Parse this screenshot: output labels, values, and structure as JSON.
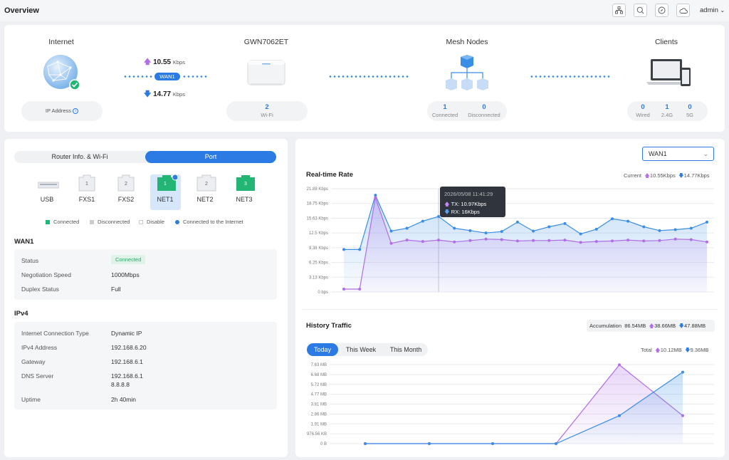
{
  "header": {
    "title": "Overview",
    "user": "admin"
  },
  "topology": {
    "internet": {
      "title": "Internet",
      "ip_label": "IP Address"
    },
    "wan": {
      "label": "WAN1",
      "up_rate": "10.55",
      "down_rate": "14.77",
      "unit": "Kbps"
    },
    "router": {
      "title": "GWN7062ET",
      "wifi_count": "2",
      "wifi_label": "Wi-Fi"
    },
    "mesh": {
      "title": "Mesh Nodes",
      "connected": "1",
      "connected_label": "Connected",
      "disconnected": "0",
      "disconnected_label": "Disconnected"
    },
    "clients": {
      "title": "Clients",
      "wired": "0",
      "wired_label": "Wired",
      "g24": "1",
      "g24_label": "2.4G",
      "g5": "0",
      "g5_label": "5G"
    }
  },
  "left": {
    "tabs": [
      "Router Info. & Wi-Fi",
      "Port"
    ],
    "ports": [
      {
        "name": "USB",
        "number": ""
      },
      {
        "name": "FXS1",
        "number": "1"
      },
      {
        "name": "FXS2",
        "number": "2"
      },
      {
        "name": "NET1",
        "number": "1"
      },
      {
        "name": "NET2",
        "number": "2"
      },
      {
        "name": "NET3",
        "number": "3"
      }
    ],
    "legend": [
      "Connected",
      "Disconnected",
      "Disable",
      "Connected to the Internet"
    ],
    "wan_title": "WAN1",
    "wan_rows": [
      {
        "label": "Status",
        "value": "Connected"
      },
      {
        "label": "Negotiation Speed",
        "value": "1000Mbps"
      },
      {
        "label": "Duplex Status",
        "value": "Full"
      }
    ],
    "ipv4_title": "IPv4",
    "ipv4_rows": [
      {
        "label": "Internet Connection Type",
        "value": "Dynamic IP"
      },
      {
        "label": "IPv4 Address",
        "value": "192.168.6.20"
      },
      {
        "label": "Gateway",
        "value": "192.168.6.1"
      },
      {
        "label": "DNS Server",
        "value": "192.168.6.1",
        "value2": "8.8.8.8"
      },
      {
        "label": "Uptime",
        "value": "2h 40min"
      }
    ]
  },
  "right": {
    "select_value": "WAN1",
    "realtime": {
      "title": "Real-time Rate",
      "current_label": "Current",
      "current_up": "10.55Kbps",
      "current_down": "14.77Kbps",
      "tooltip_time": "2026/05/08 11:41:29",
      "tooltip_tx": "TX: 10.97Kbps",
      "tooltip_rx": "RX: 16Kbps"
    },
    "history": {
      "title": "History Traffic",
      "accum_label": "Accumulation",
      "accum_total": "86.54MB",
      "accum_up": "38.66MB",
      "accum_down": "47.88MB",
      "tabs": [
        "Today",
        "This Week",
        "This Month"
      ],
      "total_label": "Total",
      "total_up": "10.12MB",
      "total_down": "9.36MB"
    }
  },
  "chart_data": [
    {
      "type": "area",
      "title": "Real-time Rate",
      "y_ticks": [
        "0 bps",
        "3.13 Kbps",
        "6.25 Kbps",
        "9.38 Kbps",
        "12.5 Kbps",
        "15.63 Kbps",
        "18.75 Kbps",
        "21.88 Kbps"
      ],
      "ylim": [
        0,
        21.88
      ],
      "series": [
        {
          "name": "RX",
          "color": "#3a8ee6",
          "values": [
            9.0,
            9.0,
            20.5,
            12.9,
            13.5,
            15.0,
            16.0,
            13.5,
            13.0,
            12.5,
            12.8,
            14.8,
            12.9,
            13.8,
            14.5,
            12.3,
            13.3,
            15.5,
            15.0,
            13.8,
            13.0,
            13.2,
            13.5,
            14.8
          ]
        },
        {
          "name": "TX",
          "color": "#b06ee8",
          "values": [
            0.6,
            0.6,
            20.0,
            10.3,
            11.0,
            10.7,
            11.0,
            10.6,
            10.9,
            11.2,
            11.1,
            10.8,
            10.9,
            10.9,
            11.0,
            10.5,
            10.7,
            10.8,
            11.0,
            10.8,
            10.9,
            11.2,
            11.1,
            10.6
          ]
        }
      ],
      "grid": true
    },
    {
      "type": "area",
      "title": "History Traffic",
      "y_ticks": [
        "0 B",
        "976.56 KB",
        "1.91 MB",
        "2.86 MB",
        "3.81 MB",
        "4.77 MB",
        "5.72 MB",
        "6.68 MB",
        "7.63 MB"
      ],
      "ylim": [
        0,
        7.63
      ],
      "series": [
        {
          "name": "TX",
          "color": "#b06ee8",
          "values": [
            0,
            0,
            0,
            0,
            7.6,
            2.7
          ]
        },
        {
          "name": "RX",
          "color": "#3a8ee6",
          "values": [
            0,
            0,
            0,
            0,
            2.7,
            6.9
          ]
        }
      ],
      "grid": true
    }
  ]
}
